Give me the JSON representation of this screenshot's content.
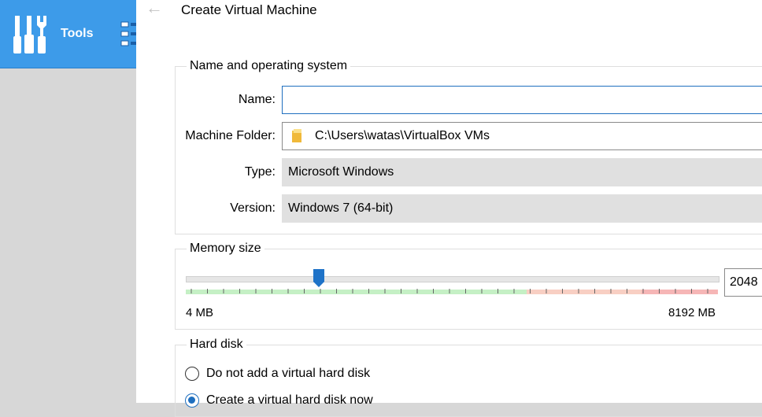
{
  "manager": {
    "tools_label": "Tools",
    "accent_color": "#3d9be9"
  },
  "dialog": {
    "title": "Create Virtual Machine",
    "back_icon": "back-arrow-icon"
  },
  "name_os": {
    "title": "Name and operating system",
    "name_label": "Name:",
    "name_value": "",
    "folder_label": "Machine Folder:",
    "folder_value": "C:\\Users\\watas\\VirtualBox VMs",
    "type_label": "Type:",
    "type_value": "Microsoft Windows",
    "version_label": "Version:",
    "version_value": "Windows 7 (64-bit)"
  },
  "memory": {
    "title": "Memory size",
    "min_label": "4 MB",
    "max_label": "8192 MB",
    "value": "2048",
    "slider_fraction": 0.25
  },
  "hard_disk": {
    "title": "Hard disk",
    "options": [
      {
        "label": "Do not add a virtual hard disk",
        "checked": false
      },
      {
        "label": "Create a virtual hard disk now",
        "checked": true
      }
    ]
  }
}
